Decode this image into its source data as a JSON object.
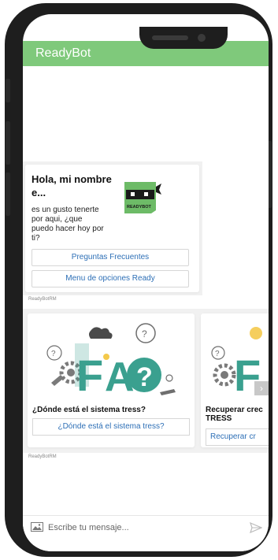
{
  "app": {
    "title": "ReadyBot"
  },
  "greeting": {
    "title": "Hola, mi nombre e...",
    "subtitle": "es un gusto tenerte por aqui, ¿que puedo hacer hoy por ti?",
    "logo_text": "READYBOT",
    "buttons": [
      {
        "label": "Preguntas Frecuentes"
      },
      {
        "label": "Menu de opciones Ready"
      }
    ],
    "sender": "ReadyBotRM"
  },
  "carousel": {
    "cards": [
      {
        "image": "faq-illustration",
        "caption": "¿Dónde está el sistema tress?",
        "button": "¿Dónde está el sistema tress?"
      },
      {
        "image": "faq-illustration",
        "caption": "Recuperar crec TRESS",
        "button": "Recuperar cr"
      }
    ],
    "next_icon": "chevron-right-icon",
    "sender": "ReadyBotRM"
  },
  "composer": {
    "placeholder": "Escribe tu mensaje...",
    "attach_icon": "image-icon",
    "send_icon": "send-icon"
  },
  "colors": {
    "header": "#7fc97b",
    "link": "#2d6fb6",
    "bot_green": "#6dbb67",
    "faq_teal": "#3aa08f"
  }
}
